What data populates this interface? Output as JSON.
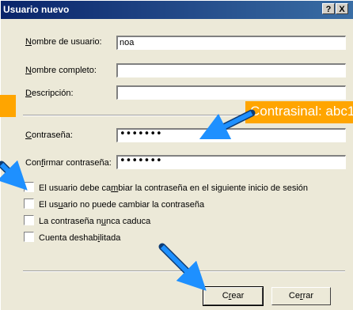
{
  "window": {
    "title": "Usuario nuevo",
    "help_label": "?",
    "close_label": "X"
  },
  "fields": {
    "username": {
      "label_pre": "",
      "label_key": "N",
      "label_post": "ombre de usuario:",
      "value": "noa"
    },
    "fullname": {
      "label_pre": "",
      "label_key": "N",
      "label_post": "ombre completo:",
      "value": ""
    },
    "description": {
      "label_pre": "",
      "label_key": "D",
      "label_post": "escripción:",
      "value": ""
    },
    "password": {
      "label_pre": "",
      "label_key": "C",
      "label_post": "ontraseña:",
      "value": "•••••••"
    },
    "confirm": {
      "label_pre": "Con",
      "label_key": "f",
      "label_post": "irmar contraseña:",
      "value": "•••••••"
    }
  },
  "checkboxes": [
    {
      "pre": "El usuario debe ca",
      "key": "m",
      "post": "biar la contraseña en el siguiente inicio de sesión",
      "checked": false
    },
    {
      "pre": "El us",
      "key": "u",
      "post": "ario no puede cambiar la contraseña",
      "checked": false
    },
    {
      "pre": "La contraseña n",
      "key": "u",
      "post": "nca caduca",
      "checked": false
    },
    {
      "pre": "Cuenta deshab",
      "key": "i",
      "post": "litada",
      "checked": false
    }
  ],
  "buttons": {
    "create": {
      "pre": "C",
      "key": "r",
      "post": "ear"
    },
    "close": {
      "pre": "Ce",
      "key": "r",
      "post": "rar"
    }
  },
  "annotation": {
    "text": "Contrasinal: abc1",
    "color": "#ffa500",
    "arrow_color": "#1e90ff"
  }
}
